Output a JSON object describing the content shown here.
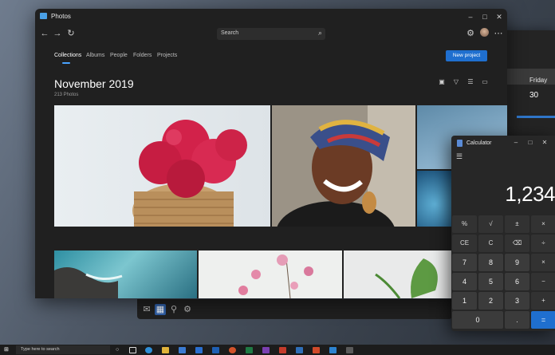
{
  "calendar_window": {
    "day": "Friday",
    "date": "30"
  },
  "photos": {
    "title": "Photos",
    "search_placeholder": "Search",
    "tabs": [
      "Collections",
      "Albums",
      "People",
      "Folders",
      "Projects"
    ],
    "active_tab": "Collections",
    "new_project_label": "New project",
    "heading": "November 2019",
    "photo_count": "213 Photos",
    "accent": "#1f6fcf"
  },
  "calculator": {
    "title": "Calculator",
    "display": "1,234",
    "rows": [
      [
        "%",
        "√",
        "±",
        "×"
      ],
      [
        "CE",
        "C",
        "⌫",
        "÷"
      ],
      [
        "7",
        "8",
        "9",
        "×"
      ],
      [
        "4",
        "5",
        "6",
        "−"
      ],
      [
        "1",
        "2",
        "3",
        "+"
      ],
      [
        "0",
        ".",
        "",
        "="
      ]
    ]
  },
  "taskbar": {
    "search_placeholder": "Type here to search"
  },
  "icons": {
    "photos_app": "photos-app-icon",
    "back": "back-arrow-icon",
    "forward": "forward-arrow-icon",
    "refresh": "refresh-icon",
    "settings": "gear-icon",
    "more": "more-icon"
  }
}
